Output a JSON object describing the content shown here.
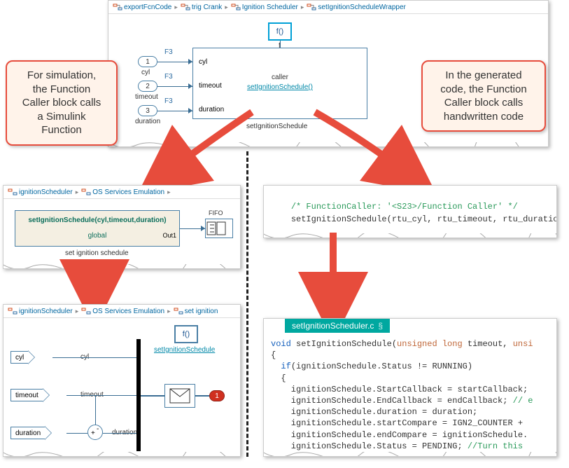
{
  "panels": {
    "top": {
      "crumbs": [
        "exportFcnCode",
        "trig Crank",
        "Ignition Scheduler",
        "setIgnitionScheduleWrapper"
      ],
      "fn_label": "f()",
      "fn_short": "f",
      "ports": [
        {
          "num": "1",
          "name": "cyl",
          "tag": "F3"
        },
        {
          "num": "2",
          "name": "timeout",
          "tag": "F3"
        },
        {
          "num": "3",
          "name": "duration",
          "tag": "F3"
        }
      ],
      "caller_title": "caller",
      "caller_fn": "setIgnitionSchedule()",
      "caller_in": [
        "cyl",
        "timeout",
        "duration"
      ],
      "sub_label": "setIgnitionSchedule"
    },
    "midleft": {
      "crumbs": [
        "ignitionScheduler",
        "OS Services Emulation"
      ],
      "block_sig": "setIgnitionSchedule(cyl,timeout,duration)",
      "block_scope": "global",
      "block_out": "Out1",
      "block_label": "set ignition schedule",
      "fifo_label": "FIFO"
    },
    "botleft": {
      "crumbs": [
        "ignitionScheduler",
        "OS Services Emulation",
        "set ignition"
      ],
      "fn_label": "f()",
      "fn_link": "setIgnitionSchedule",
      "ports": [
        "cyl",
        "timeout",
        "duration"
      ],
      "term_label": "1"
    },
    "codecall": {
      "comment": "/* FunctionCaller: '<S23>/Function Caller' */",
      "call": "setIgnitionSchedule(rtu_cyl, rtu_timeout, rtu_duration"
    },
    "filetab": "setIgnitionScheduler.c",
    "filetab_suffix": "§",
    "codebody": [
      {
        "frag": [
          {
            "t": "void ",
            "c": "code-kw"
          },
          {
            "t": "setIgnitionSchedule(",
            "c": ""
          },
          {
            "t": "unsigned long",
            "c": "code-type"
          },
          {
            "t": " timeout, ",
            "c": ""
          },
          {
            "t": "unsi",
            "c": "code-type"
          }
        ]
      },
      {
        "frag": [
          {
            "t": "{",
            "c": ""
          }
        ]
      },
      {
        "frag": [
          {
            "t": "  if",
            "c": "code-kw"
          },
          {
            "t": "(ignitionSchedule.Status != RUNNING)",
            "c": ""
          }
        ]
      },
      {
        "frag": [
          {
            "t": "  {",
            "c": ""
          }
        ]
      },
      {
        "frag": [
          {
            "t": "    ignitionSchedule.StartCallback = startCallback;",
            "c": ""
          }
        ]
      },
      {
        "frag": [
          {
            "t": "    ignitionSchedule.EndCallback = endCallback; ",
            "c": ""
          },
          {
            "t": "// e",
            "c": "code-comment"
          }
        ]
      },
      {
        "frag": [
          {
            "t": "    ignitionSchedule.duration = duration;",
            "c": ""
          }
        ]
      },
      {
        "frag": [
          {
            "t": "    ignitionSchedule.startCompare = IGN2_COUNTER +",
            "c": ""
          }
        ]
      },
      {
        "frag": [
          {
            "t": "    ignitionSchedule.endCompare = ignitionSchedule.",
            "c": ""
          }
        ]
      },
      {
        "frag": [
          {
            "t": "    ignitionSchedule.Status = PENDING; ",
            "c": ""
          },
          {
            "t": "//Turn this ",
            "c": "code-comment"
          }
        ]
      }
    ]
  },
  "callouts": {
    "left": "For simulation,\nthe Function\nCaller block calls\na Simulink\nFunction",
    "right": "In the generated\ncode, the Function\nCaller block calls\nhandwritten code"
  },
  "colors": {
    "accent_red": "#e74c3c",
    "sim_blue": "#4a7fa5",
    "link_teal": "#0088a8",
    "code_tab": "#00a8a0"
  }
}
